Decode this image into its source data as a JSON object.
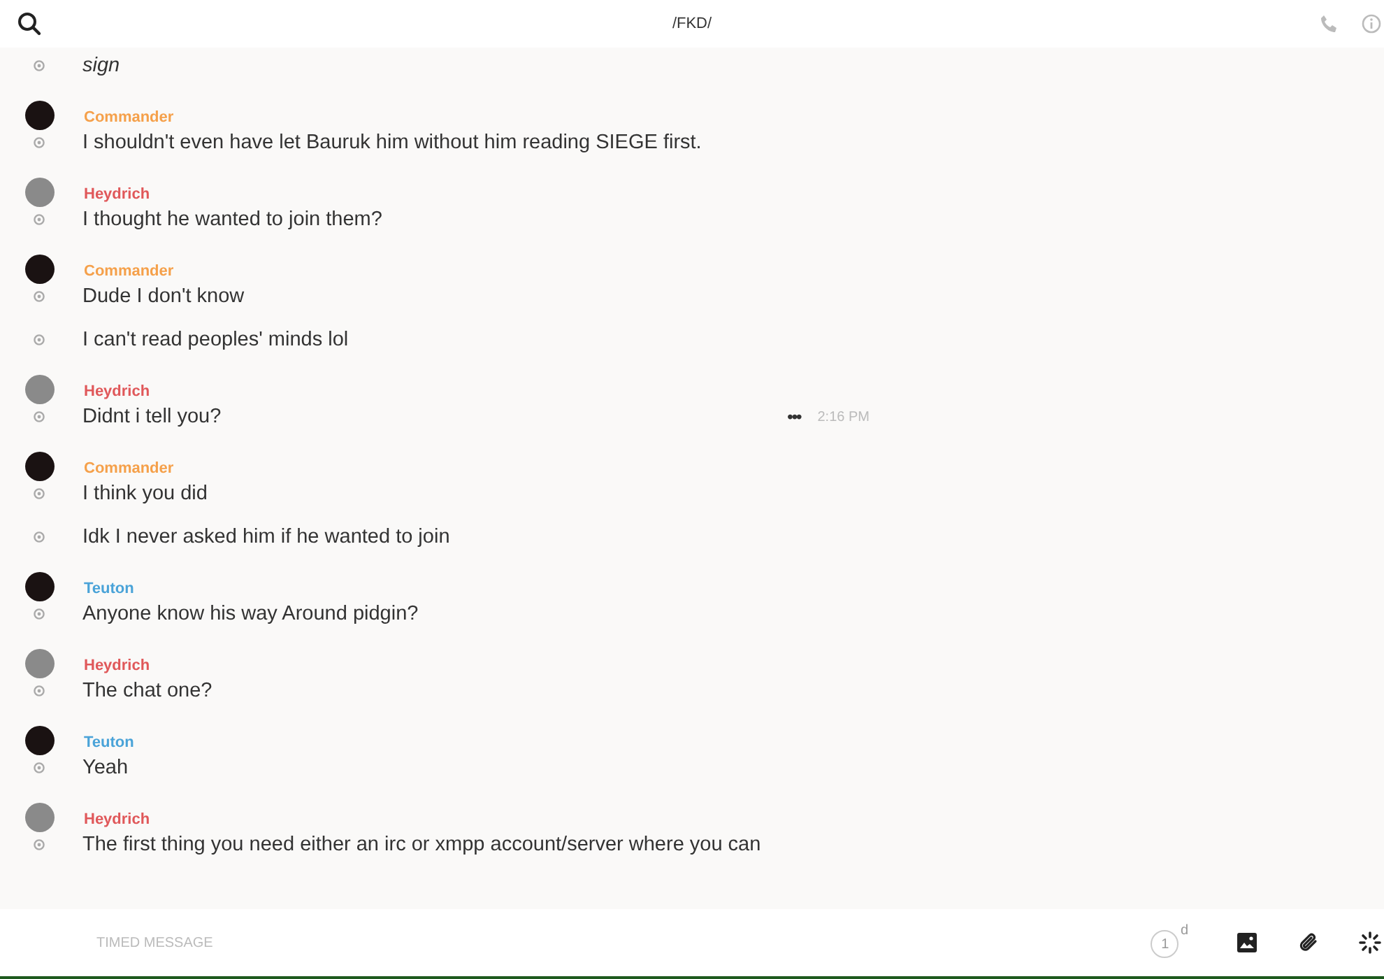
{
  "header": {
    "title": "/FKD/"
  },
  "messages": [
    {
      "messages": [
        {
          "text": "sign",
          "italic": true
        }
      ]
    },
    {
      "sender": "Commander",
      "color": "#f5a04a",
      "kind": "dark",
      "messages": [
        {
          "text": "I shouldn't even have let Bauruk him without him reading SIEGE first.",
          "italic": false
        }
      ]
    },
    {
      "sender": "Heydrich",
      "color": "#e0585a",
      "kind": "grey",
      "messages": [
        {
          "text": "I thought he wanted to join them?",
          "italic": false
        }
      ]
    },
    {
      "sender": "Commander",
      "color": "#f5a04a",
      "kind": "dark",
      "messages": [
        {
          "text": "Dude I don't know",
          "italic": false
        },
        {
          "text": "I can't read peoples' minds lol",
          "italic": false
        }
      ]
    },
    {
      "sender": "Heydrich",
      "color": "#e0585a",
      "kind": "grey",
      "messages": [
        {
          "text": "Didnt i tell you?",
          "italic": false,
          "more": "•••",
          "time": "2:16 PM"
        }
      ]
    },
    {
      "sender": "Commander",
      "color": "#f5a04a",
      "kind": "dark",
      "messages": [
        {
          "text": "I think you did",
          "italic": false
        },
        {
          "text": "Idk I never asked him if he wanted to join",
          "italic": false
        }
      ]
    },
    {
      "sender": "Teuton",
      "color": "#4aa3d8",
      "kind": "dark",
      "messages": [
        {
          "text": "Anyone know his way Around pidgin?",
          "italic": false
        }
      ]
    },
    {
      "sender": "Heydrich",
      "color": "#e0585a",
      "kind": "grey",
      "messages": [
        {
          "text": "The chat one?",
          "italic": false
        }
      ]
    },
    {
      "sender": "Teuton",
      "color": "#4aa3d8",
      "kind": "dark",
      "messages": [
        {
          "text": "Yeah",
          "italic": false
        }
      ]
    },
    {
      "sender": "Heydrich",
      "color": "#e0585a",
      "kind": "grey",
      "messages": [
        {
          "text": "The first thing you need either an irc or xmpp account/server where you can",
          "italic": false
        }
      ]
    }
  ],
  "composer": {
    "placeholder": "TIMED MESSAGE",
    "timer_value": "1",
    "timer_unit": "d"
  }
}
